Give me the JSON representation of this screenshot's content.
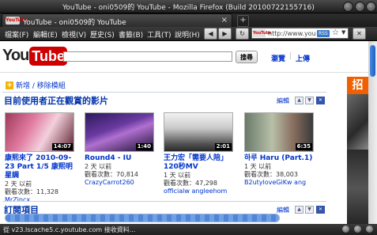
{
  "window": {
    "title": "YouTube - oni0509的 YouTube - Mozilla Firefox (Build 20100722155716)"
  },
  "tabs": [
    {
      "label": "YouTube - oni0509的 YouTube",
      "favicon": "YouTube",
      "close": "×"
    }
  ],
  "tab_add": "+",
  "menu": [
    "檔案(F)",
    "編輯(E)",
    "檢視(V)",
    "歷史(S)",
    "書籤(B)",
    "工具(T)",
    "說明(H)"
  ],
  "nav": {
    "back": "◀",
    "forward": "▶",
    "reload": "↻",
    "stop": "✕"
  },
  "address": {
    "url": "http://www.you...",
    "site_badge": "YouTube",
    "rss": "RSS",
    "star": "☆"
  },
  "page": {
    "logo_you": "You",
    "logo_tube": "Tube",
    "search_value": "",
    "search_button": "搜尋",
    "links": [
      "瀏覽",
      "上傳"
    ],
    "add_modules_icon": "+",
    "add_modules": "新增 / 移除模組",
    "section1": {
      "title": "目前使用者正在觀賞的影片",
      "edit": "編輯",
      "controls": [
        "▲",
        "▼",
        "✕"
      ]
    },
    "section2": {
      "title": "訂閱項目",
      "edit": "編輯",
      "controls": [
        "▲",
        "▼",
        "✕"
      ]
    },
    "videos": [
      {
        "title": "康熙來了 2010-09-23 Part 1/5 康熙明星調",
        "duration": "14:07",
        "age": "2 天 以前",
        "views": "觀看次數：11,328",
        "user": "MrZincx"
      },
      {
        "title": "Round4 - IU",
        "duration": "1:40",
        "age": "2 天 以前",
        "views": "觀看次數：70,814",
        "user": "CrazyCarrot260"
      },
      {
        "title": "王力宏「需要人陪」120秒MV",
        "duration": "2:01",
        "age": "1 天 以前",
        "views": "觀看次數：47,298",
        "user": "officialw angleehom"
      },
      {
        "title": "하루 Haru (Part.1)",
        "duration": "6:35",
        "age": "1 天 以前",
        "views": "觀看次數：38,003",
        "user": "B2utyloveGiKw ang"
      }
    ],
    "ad_text": "招",
    "progress": 1.0
  },
  "status": {
    "text": "從 v23.lscache5.c.youtube.com 接收資料..."
  },
  "colors": {
    "link": "#0033cc",
    "section_title": "#0033aa",
    "brand_red": "#cc0000",
    "chrome_dark": "#222222"
  }
}
